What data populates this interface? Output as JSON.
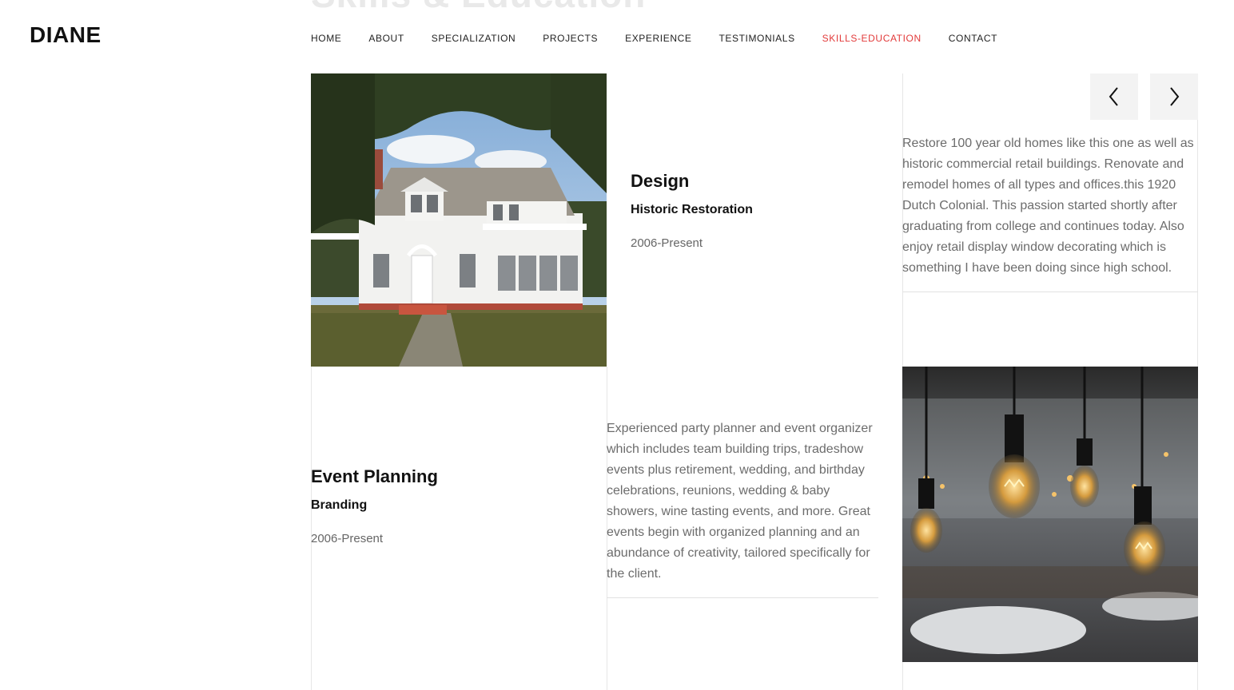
{
  "header": {
    "logo": "DIANE",
    "section_heading": "Skills & Education",
    "nav": [
      {
        "label": "HOME"
      },
      {
        "label": "ABOUT"
      },
      {
        "label": "SPECIALIZATION"
      },
      {
        "label": "PROJECTS"
      },
      {
        "label": "EXPERIENCE"
      },
      {
        "label": "TESTIMONIALS"
      },
      {
        "label": "SKILLS-EDUCATION",
        "active": true
      },
      {
        "label": "CONTACT"
      }
    ],
    "active_color": "#e23a3a"
  },
  "slider": {
    "prev_icon": "chevron-left-icon",
    "next_icon": "chevron-right-icon"
  },
  "cards": [
    {
      "title": "Design",
      "subtitle": "Historic Restoration",
      "date": "2006-Present",
      "description": "Restore 100 year old homes like this one as well as historic commercial retail buildings. Renovate and remodel homes of all types and offices.this 1920 Dutch Colonial. This passion started shortly after graduating from college and continues today. Also enjoy retail display window decorating which is something I have been doing since high school.",
      "image": "white-colonial-house-photo"
    },
    {
      "title": "Event Planning",
      "subtitle": "Branding",
      "date": "2006-Present",
      "description": "Experienced party planner and event organizer which includes team building trips, tradeshow events plus retirement, wedding, and birthday celebrations, reunions, wedding & baby showers, wine tasting events, and more. Great events begin with organized planning and an abundance of creativity, tailored specifically for the client.",
      "image": "hanging-bulbs-event-photo"
    }
  ]
}
